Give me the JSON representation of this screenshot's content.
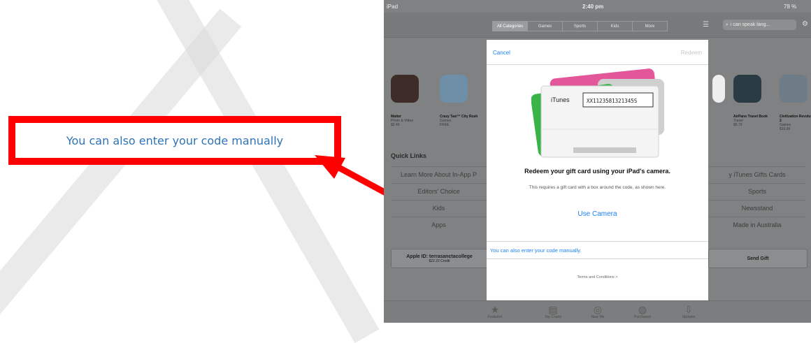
{
  "annotation": {
    "text": "You can also enter your code manually"
  },
  "status_bar": {
    "device": "iPad",
    "time": "2:40 pm",
    "battery": "78 %"
  },
  "top_nav": {
    "segments": [
      "All Categories",
      "Games",
      "Sports",
      "Kids",
      "More"
    ],
    "selected": "All Categories",
    "search_value": "i can speak lang..."
  },
  "apps": [
    {
      "name": "Matter",
      "cat": "Photo & Video",
      "price": "$2.49"
    },
    {
      "name": "Crazy Taxi™ City Rush",
      "cat": "Games",
      "price": "FREE"
    },
    {
      "name": "AirPano Travel Book",
      "cat": "Travel",
      "price": "$5.79"
    },
    {
      "name": "Civilization Revolution 2",
      "cat": "Games",
      "price": "$19.99"
    }
  ],
  "quick_links": {
    "title": "Quick Links",
    "left": [
      "Learn More About In-App P",
      "Editors' Choice",
      "Kids",
      "Apps"
    ],
    "right": [
      "y iTunes Gifts Cards",
      "Sports",
      "Newsstand",
      "Made in Australia"
    ]
  },
  "account": {
    "apple_id": "Apple ID: terrasanctacollege",
    "credit": "$22.22 Credit",
    "send_gift": "Send Gift"
  },
  "tab_bar": [
    "Featured",
    "Top Charts",
    "Near Me",
    "Purchased",
    "Updates"
  ],
  "modal": {
    "cancel": "Cancel",
    "redeem": "Redeem",
    "card_brand": "iTunes",
    "card_code": "XX1123581321345S",
    "heading": "Redeem your gift card using your iPad's camera.",
    "subtext": "This requires a gift card with a box around the code, as shown here.",
    "use_camera": "Use Camera",
    "manual": "You can also enter your code manually.",
    "terms": "Terms and Conditions >"
  },
  "colors": {
    "accent": "#1a82fb",
    "annotation_red": "#ff0000",
    "annotation_text": "#2e74b5"
  }
}
